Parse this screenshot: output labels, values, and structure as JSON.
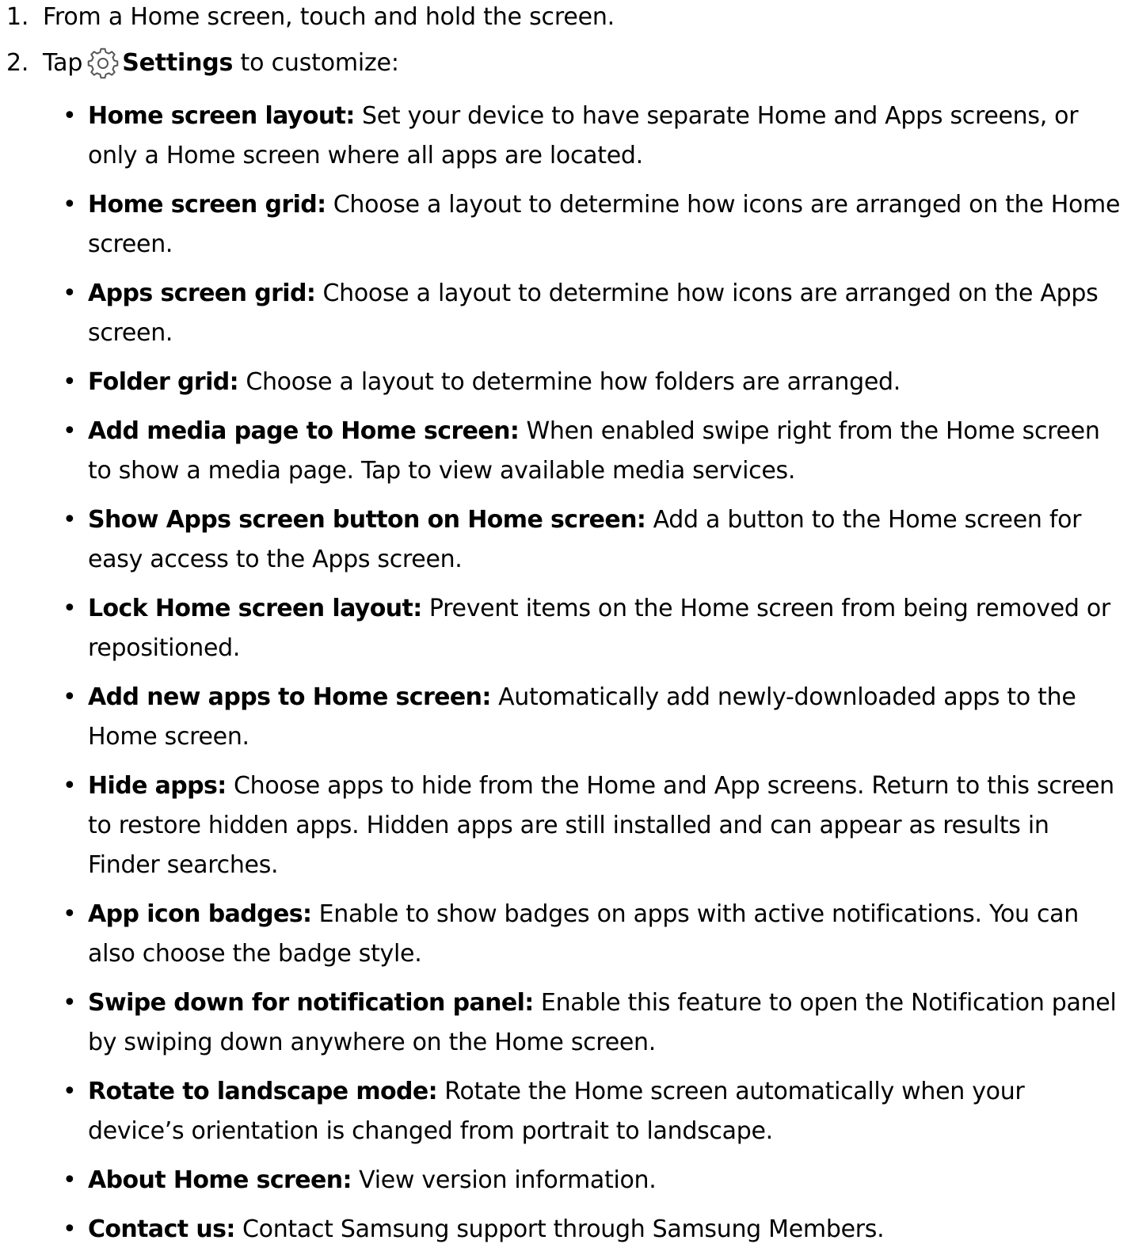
{
  "steps": [
    {
      "number": "1.",
      "text": "From a Home screen, touch and hold the screen."
    },
    {
      "number": "2.",
      "prefix": "Tap",
      "icon": "gear-icon",
      "bold": "Settings",
      "suffix": "to customize:"
    }
  ],
  "settings": [
    {
      "term": "Home screen layout:",
      "desc": "Set your device to have separate Home and Apps screens, or only a Home screen where all apps are located."
    },
    {
      "term": "Home screen grid:",
      "desc": "Choose a layout to determine how icons are arranged on the Home screen."
    },
    {
      "term": "Apps screen grid:",
      "desc": "Choose a layout to determine how icons are arranged on the Apps screen."
    },
    {
      "term": "Folder grid:",
      "desc": "Choose a layout to determine how folders are arranged."
    },
    {
      "term": "Add media page to Home screen:",
      "desc": "When enabled swipe right from the Home screen to show a media page. Tap to view available media services."
    },
    {
      "term": "Show Apps screen button on Home screen:",
      "desc": "Add a button to the Home screen for easy access to the Apps screen."
    },
    {
      "term": "Lock Home screen layout:",
      "desc": "Prevent items on the Home screen from being removed or repositioned."
    },
    {
      "term": "Add new apps to Home screen:",
      "desc": "Automatically add newly-downloaded apps to the Home screen."
    },
    {
      "term": "Hide apps:",
      "desc": "Choose apps to hide from the Home and App screens. Return to this screen to restore hidden apps. Hidden apps are still installed and can appear as results in Finder searches."
    },
    {
      "term": "App icon badges:",
      "desc": "Enable to show badges on apps with active notifications. You can also choose the badge style."
    },
    {
      "term": "Swipe down for notification panel:",
      "desc": "Enable this feature to open the Notification panel by swiping down anywhere on the Home screen."
    },
    {
      "term": "Rotate to landscape mode:",
      "desc": "Rotate the Home screen automatically when your device’s orientation is changed from portrait to landscape."
    },
    {
      "term": "About Home screen:",
      "desc": "View version information."
    },
    {
      "term": "Contact us:",
      "desc": "Contact Samsung support through Samsung Members."
    }
  ]
}
